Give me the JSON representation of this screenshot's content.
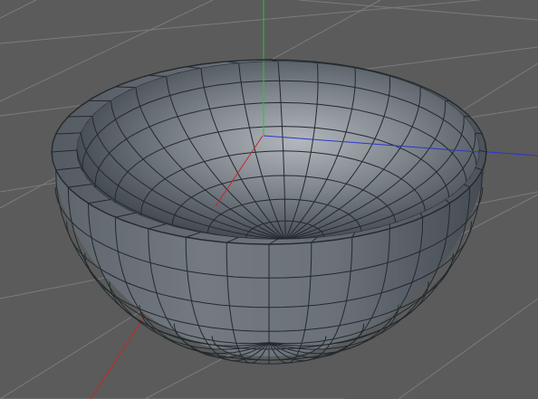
{
  "viewport": {
    "background_color": "#5b5b5b",
    "grid_color": "#7b7b7b",
    "wire_color": "#222a2e"
  },
  "axes": {
    "x_color": "#c82626",
    "y_color": "#27c43a",
    "z_color": "#2a37c8"
  },
  "bowl": {
    "kind": "hemisphere",
    "shading": "gray-blue",
    "segments_around": 32,
    "segments_down": 8
  }
}
